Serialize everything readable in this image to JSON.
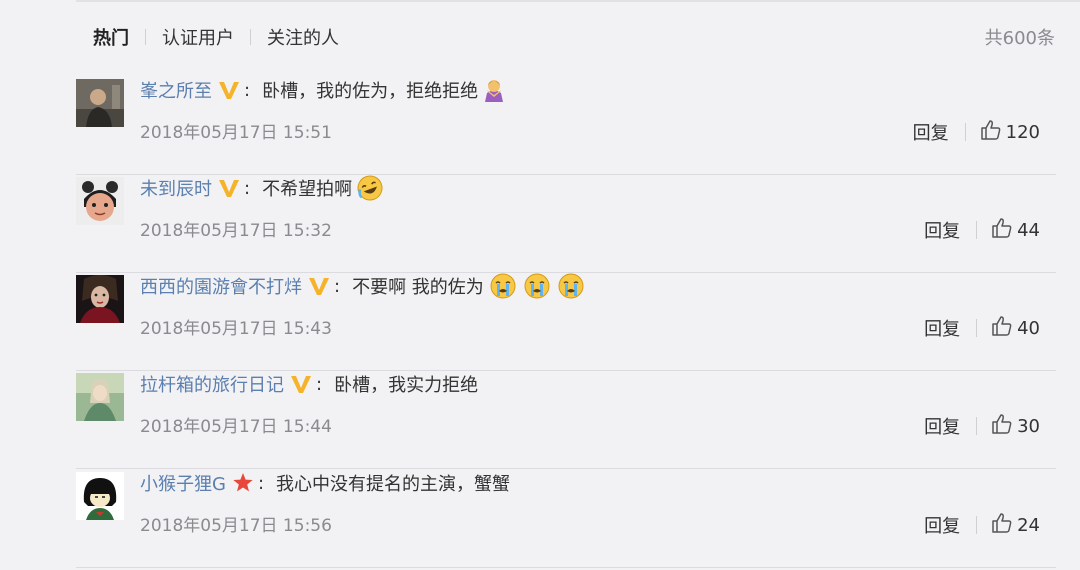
{
  "filters": {
    "hot": "热门",
    "verified": "认证用户",
    "following": "关注的人"
  },
  "total": "共600条",
  "comments": [
    {
      "username": "峯之所至",
      "badge": "verified-v",
      "text": "卧槽，我的佐为，拒绝拒绝",
      "emoji": "woman-gesturing-no",
      "time": "2018年05月17日 15:51",
      "reply": "回复",
      "likes": "120"
    },
    {
      "username": "未到辰时",
      "badge": "verified-v",
      "text": "不希望拍啊",
      "emoji": "crying-laughing",
      "time": "2018年05月17日 15:32",
      "reply": "回复",
      "likes": "44"
    },
    {
      "username": "西西的園游會不打烊",
      "badge": "verified-v",
      "text": "不要啊 我的佐为",
      "emoji": "crying-face x3",
      "time": "2018年05月17日 15:43",
      "reply": "回复",
      "likes": "40"
    },
    {
      "username": "拉杆箱的旅行日记",
      "badge": "verified-v",
      "text": "卧槽，我实力拒绝",
      "time": "2018年05月17日 15:44",
      "reply": "回复",
      "likes": "30"
    },
    {
      "username": "小猴子狸G",
      "badge": "red-star",
      "text": "我心中没有提名的主演，蟹蟹",
      "time": "2018年05月17日 15:56",
      "reply": "回复",
      "likes": "24"
    }
  ],
  "colors": {
    "background": "#f2f2f5",
    "username": "#5b7fae",
    "verified_badge": "#f5b32b",
    "star_badge": "#e8483a",
    "muted_text": "#8a8a8f"
  }
}
